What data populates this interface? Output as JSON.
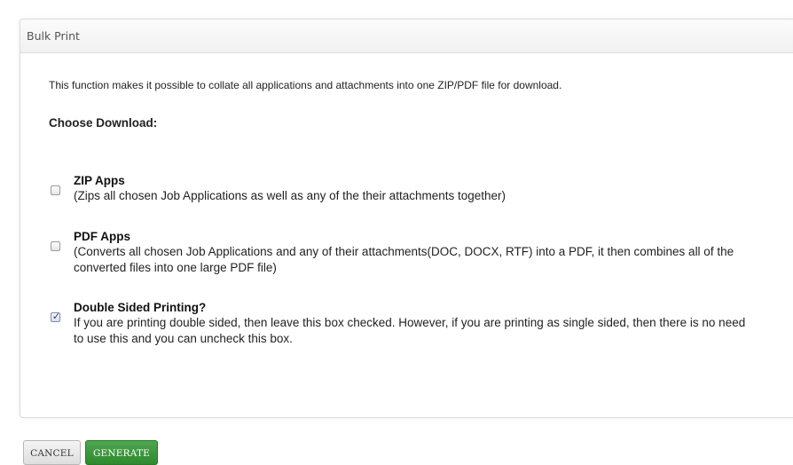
{
  "panel": {
    "title": "Bulk Print",
    "intro": "This function makes it possible to collate all applications and attachments into one ZIP/PDF file for download.",
    "choose_label": "Choose Download:"
  },
  "options": [
    {
      "title": "ZIP Apps",
      "description": "(Zips all chosen Job Applications as well as any of the their attachments together)",
      "checked": false
    },
    {
      "title": "PDF Apps",
      "description": "(Converts all chosen Job Applications and any of their attachments(DOC, DOCX, RTF) into a PDF, it then combines all of the converted files into one large PDF file)",
      "checked": false
    },
    {
      "title": "Double Sided Printing?",
      "description": "If you are printing double sided, then leave this box checked. However, if you are printing as single sided, then there is no need to use this and you can uncheck this box.",
      "checked": true
    }
  ],
  "buttons": {
    "cancel_label": "CANCEL",
    "generate_label": "GENERATE"
  },
  "colors": {
    "generate_button": "#3b953b",
    "panel_border": "#dcdcdc"
  }
}
